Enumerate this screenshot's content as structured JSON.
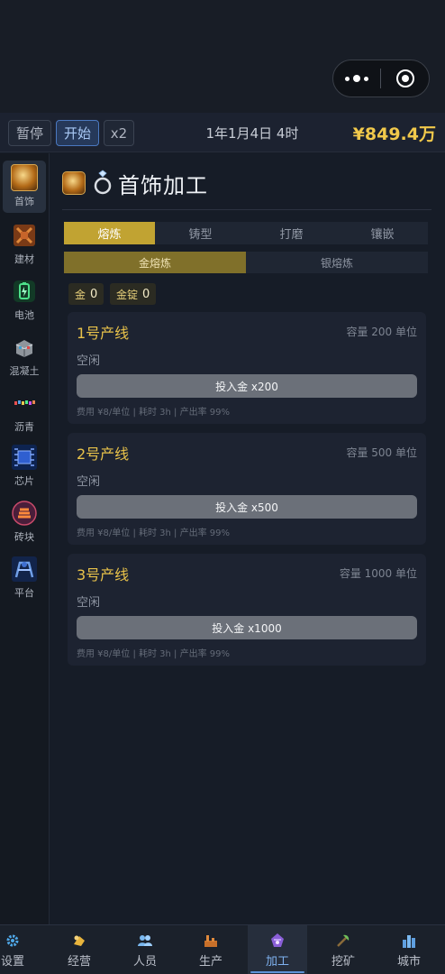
{
  "capsule": {
    "more_icon": "more-dots-icon",
    "close_icon": "target-circle-icon"
  },
  "topbar": {
    "pause_label": "暂停",
    "start_label": "开始",
    "speed_label": "x2",
    "datetime": "1年1月4日 4时",
    "money": "¥849.4万"
  },
  "sidebar": {
    "items": [
      {
        "label": "首饰",
        "icon": "jewelry-icon",
        "active": true
      },
      {
        "label": "建材",
        "icon": "building-material-icon"
      },
      {
        "label": "电池",
        "icon": "battery-icon"
      },
      {
        "label": "混凝土",
        "icon": "concrete-icon"
      },
      {
        "label": "沥青",
        "icon": "asphalt-icon"
      },
      {
        "label": "芯片",
        "icon": "chip-icon"
      },
      {
        "label": "砖块",
        "icon": "brick-icon"
      },
      {
        "label": "平台",
        "icon": "platform-icon"
      }
    ]
  },
  "header": {
    "title": "首饰加工",
    "icons": [
      "jewelry-icon",
      "ring-icon"
    ]
  },
  "tabs": [
    "熔炼",
    "铸型",
    "打磨",
    "镶嵌"
  ],
  "subtabs": [
    "金熔炼",
    "银熔炼"
  ],
  "inventory": [
    {
      "label": "金",
      "value": "0"
    },
    {
      "label": "金锭",
      "value": "0"
    }
  ],
  "lines": [
    {
      "name": "1号产线",
      "capacity": "容量 200 单位",
      "status": "空闲",
      "button": "投入金 x200",
      "meta": "费用 ¥8/单位 | 耗时 3h | 产出率 99%"
    },
    {
      "name": "2号产线",
      "capacity": "容量 500 单位",
      "status": "空闲",
      "button": "投入金 x500",
      "meta": "费用 ¥8/单位 | 耗时 3h | 产出率 99%"
    },
    {
      "name": "3号产线",
      "capacity": "容量 1000 单位",
      "status": "空闲",
      "button": "投入金 x1000",
      "meta": "费用 ¥8/单位 | 耗时 3h | 产出率 99%"
    }
  ],
  "bottomnav": [
    {
      "label": "设置",
      "icon": "gear-icon"
    },
    {
      "label": "经营",
      "icon": "business-icon"
    },
    {
      "label": "人员",
      "icon": "people-icon"
    },
    {
      "label": "生产",
      "icon": "factory-icon"
    },
    {
      "label": "加工",
      "icon": "processing-icon",
      "active": true
    },
    {
      "label": "挖矿",
      "icon": "mining-icon"
    },
    {
      "label": "城市",
      "icon": "city-icon"
    }
  ],
  "colors": {
    "accent_gold": "#c1a332",
    "money": "#f1c94b",
    "active_blue": "#5e93d8",
    "background": "#161c27"
  }
}
